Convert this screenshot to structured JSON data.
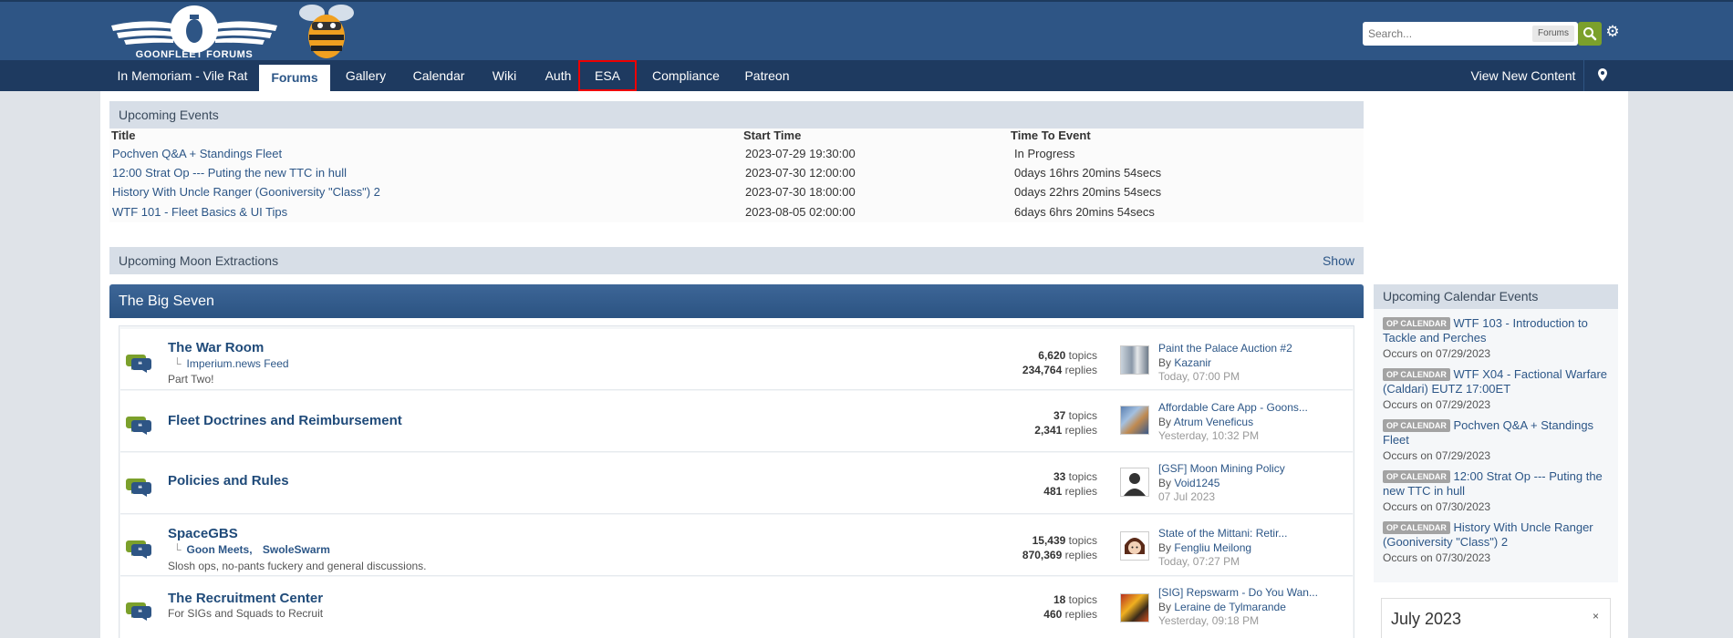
{
  "header": {
    "logo_text": "GOONFLEET FORUMS",
    "search_placeholder": "Search...",
    "search_scope": "Forums"
  },
  "nav": {
    "items": [
      "In Memoriam - Vile Rat",
      "Forums",
      "Gallery",
      "Calendar",
      "Wiki",
      "Auth",
      "ESA",
      "Compliance",
      "Patreon"
    ],
    "active": "Forums",
    "highlighted": "ESA",
    "view_new": "View New Content"
  },
  "upcoming_events": {
    "title": "Upcoming Events",
    "columns": [
      "Title",
      "Start Time",
      "Time To Event"
    ],
    "rows": [
      {
        "title": "Pochven Q&A + Standings Fleet",
        "start": "2023-07-29 19:30:00",
        "tte": "In Progress"
      },
      {
        "title": "12:00 Strat Op --- Puting the new TTC in hull",
        "start": "2023-07-30 12:00:00",
        "tte": "0days 16hrs 20mins 54secs"
      },
      {
        "title": "History With Uncle Ranger (Gooniversity \"Class\") 2",
        "start": "2023-07-30 18:00:00",
        "tte": "0days 22hrs 20mins 54secs"
      },
      {
        "title": "WTF 101 - Fleet Basics & UI Tips",
        "start": "2023-08-05 02:00:00",
        "tte": "6days 6hrs 20mins 54secs"
      }
    ]
  },
  "moon": {
    "title": "Upcoming Moon Extractions",
    "show": "Show"
  },
  "section": {
    "title": "The Big Seven"
  },
  "forums": [
    {
      "title": "The War Room",
      "subs": [
        "Imperium.news Feed"
      ],
      "desc": "Part Two!",
      "topics": "6,620",
      "replies": "234,764",
      "last_title": "Paint the Palace Auction #2",
      "last_by": "Kazanir",
      "last_date": "Today, 07:00 PM"
    },
    {
      "title": "Fleet Doctrines and Reimbursement",
      "subs": [],
      "desc": "",
      "topics": "37",
      "replies": "2,341",
      "last_title": "Affordable Care App - Goons...",
      "last_by": "Atrum Veneficus",
      "last_date": "Yesterday, 10:32 PM"
    },
    {
      "title": "Policies and Rules",
      "subs": [],
      "desc": "",
      "topics": "33",
      "replies": "481",
      "last_title": "[GSF] Moon Mining Policy",
      "last_by": "Void1245",
      "last_date": "07 Jul 2023"
    },
    {
      "title": "SpaceGBS",
      "subs": [
        "Goon Meets,",
        "SwoleSwarm"
      ],
      "desc": "Slosh ops, no-pants fuckery and general discussions.",
      "topics": "15,439",
      "replies": "870,369",
      "last_title": "State of the Mittani: Retir...",
      "last_by": "Fengliu Meilong",
      "last_date": "Today, 07:27 PM"
    },
    {
      "title": "The Recruitment Center",
      "subs": [],
      "desc": "For SIGs and Squads to Recruit",
      "topics": "18",
      "replies": "460",
      "last_title": "[SIG] Repswarm - Do You Wan...",
      "last_by": "Leraine de Tylmarande",
      "last_date": "Yesterday, 09:18 PM"
    }
  ],
  "labels": {
    "topics": "topics",
    "replies": "replies",
    "by": "By",
    "branch": "└",
    "occurs": "Occurs on"
  },
  "sidebar": {
    "title": "Upcoming Calendar Events",
    "badge": "OP CALENDAR",
    "events": [
      {
        "title": "WTF 103 - Introduction to Tackle and Perches",
        "date": "07/29/2023"
      },
      {
        "title": "WTF X04 - Factional Warfare (Caldari) EUTZ 17:00ET",
        "date": "07/29/2023"
      },
      {
        "title": "Pochven Q&A + Standings Fleet",
        "date": "07/29/2023"
      },
      {
        "title": "12:00 Strat Op --- Puting the new TTC in hull",
        "date": "07/30/2023"
      },
      {
        "title": "History With Uncle Ranger (Gooniversity \"Class\") 2",
        "date": "07/30/2023"
      }
    ],
    "month": "July 2023",
    "close": "×"
  },
  "colors": {
    "header_bg": "#2e5585",
    "nav_bg": "#1e3a60",
    "accent": "#2c5687",
    "search_btn": "#7ba02b",
    "highlight_border": "#ee0000"
  }
}
